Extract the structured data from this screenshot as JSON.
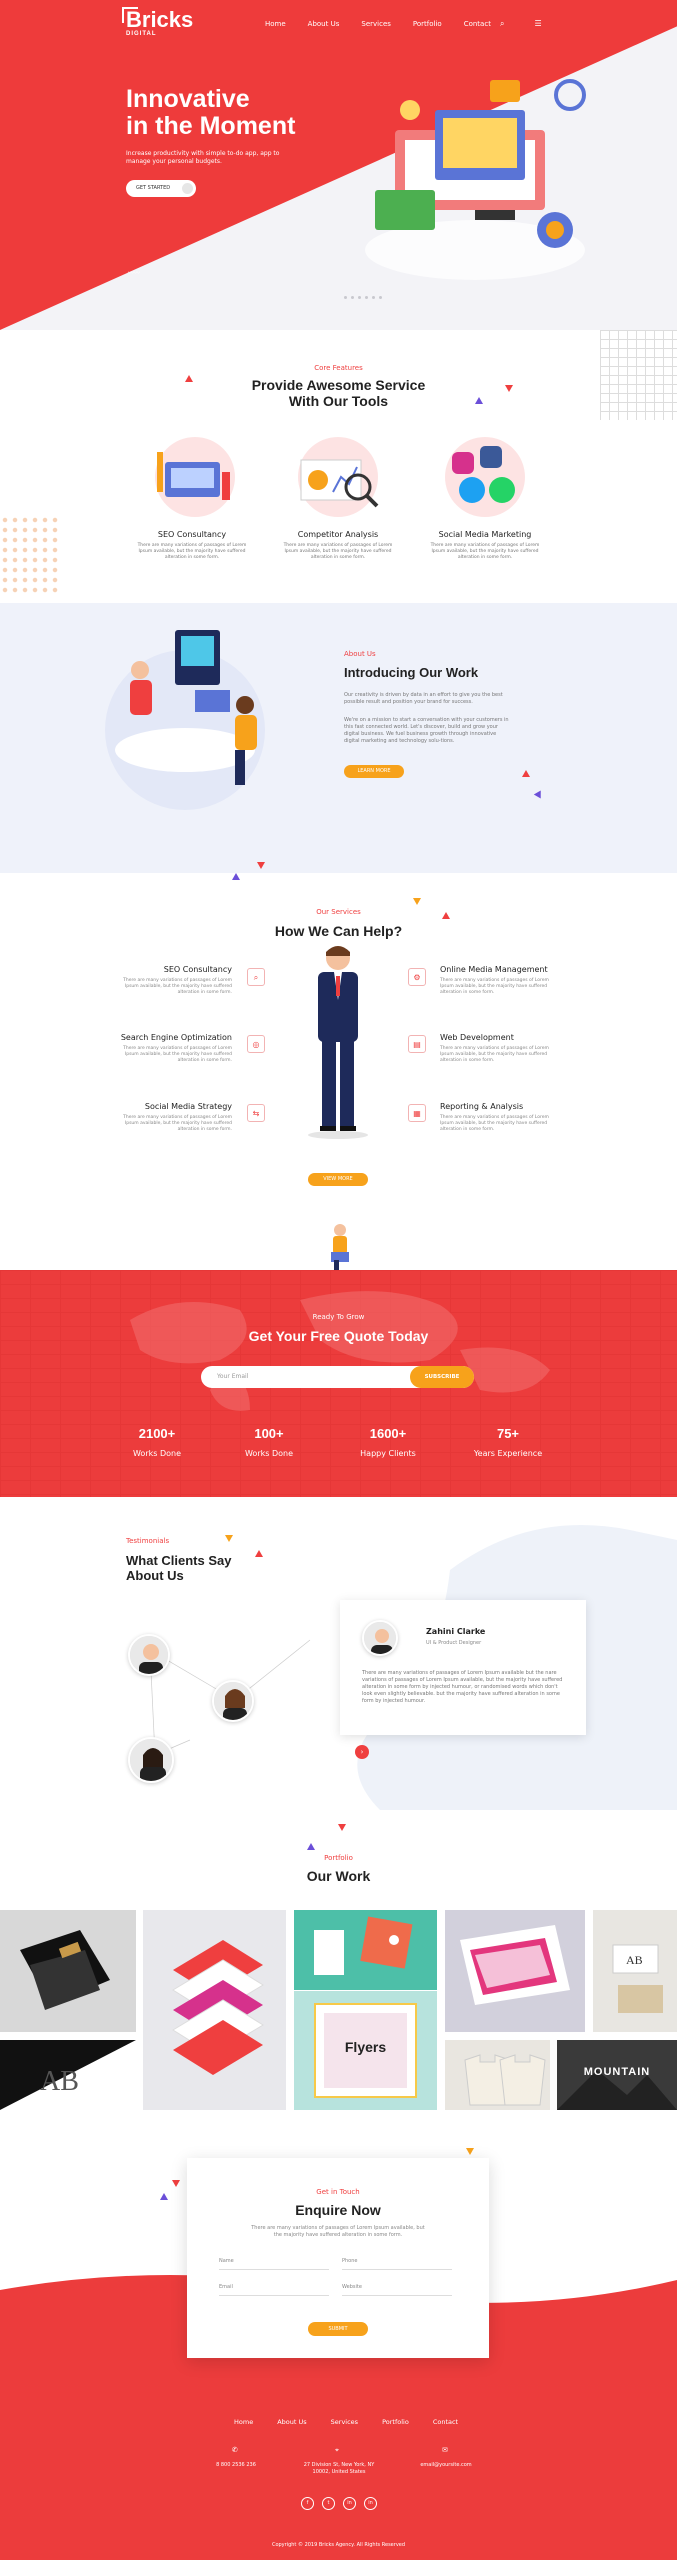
{
  "brand": {
    "name": "Bricks",
    "tag": "DIGITAL"
  },
  "nav": {
    "items": [
      "Home",
      "About Us",
      "Services",
      "Portfolio",
      "Contact"
    ],
    "search_icon": "search-icon",
    "menu_icon": "menu-icon"
  },
  "hero": {
    "title_line1": "Innovative",
    "title_line2": "in the Moment",
    "subtitle": "Increase productivity with simple to-do app, app to manage your personal budgets.",
    "cta": "GET STARTED"
  },
  "features": {
    "eyebrow": "Core Features",
    "title_line1": "Provide Awesome Service",
    "title_line2": "With Our Tools",
    "items": [
      {
        "title": "SEO Consultancy",
        "desc": "There are many variations of passages of Lorem Ipsum available, but the majority have suffered alteration in some form."
      },
      {
        "title": "Competitor Analysis",
        "desc": "There are many variations of passages of Lorem Ipsum available, but the majority have suffered alteration in some form."
      },
      {
        "title": "Social Media Marketing",
        "desc": "There are many variations of passages of Lorem Ipsum available, but the majority have suffered alteration in some form."
      }
    ]
  },
  "about": {
    "eyebrow": "About Us",
    "title": "Introducing Our Work",
    "p1": "Our creativity is driven by data in an effort to give you the best possible result and position your brand for success.",
    "p2": "We're on a mission to start a conversation with your customers in this fast connected world. Let's discover, build and grow your digital business. We fuel business growth through innovative digital marketing and technology solu-tions.",
    "cta": "LEARN MORE"
  },
  "services": {
    "eyebrow": "Our Services",
    "title": "How We Can Help?",
    "desc": "There are many variations of passages of Lorem Ipsum available, but the majority have suffered alteration in some form.",
    "left": [
      "SEO Consultancy",
      "Search Engine Optimization",
      "Social Media Strategy"
    ],
    "right": [
      "Online Media Management",
      "Web Development",
      "Reporting & Analysis"
    ],
    "cta": "VIEW MORE"
  },
  "quote": {
    "eyebrow": "Ready To Grow",
    "title": "Get Your Free Quote Today",
    "email_placeholder": "Your Email",
    "cta": "SUBSCRIBE",
    "stats": [
      {
        "value": "2100+",
        "label": "Works Done"
      },
      {
        "value": "100+",
        "label": "Works Done"
      },
      {
        "value": "1600+",
        "label": "Happy Clients"
      },
      {
        "value": "75+",
        "label": "Years Experience"
      }
    ]
  },
  "testimonials": {
    "eyebrow": "Testimonials",
    "title_line1": "What Clients Say",
    "title_line2": "About Us",
    "name": "Zahini Clarke",
    "role": "UI & Product Designer",
    "text": "There are many variations of passages of Lorem Ipsum available but the nare variations of passages of Lorem Ipsum available, but the majority have suffered alteration in some form by injected humour, or randomised words which don't look even slightly believable. but the majority have suffered alteration in some form by injected humour."
  },
  "portfolio": {
    "eyebrow": "Portfolio",
    "title": "Our Work",
    "flyers_label": "Flyers",
    "mountain_label": "MOUNTAIN"
  },
  "contact": {
    "eyebrow": "Get in Touch",
    "title": "Enquire Now",
    "desc": "There are many variations of passages of Lorem Ipsum available, but the majority have suffered alteration in some form.",
    "fields": [
      "Name",
      "Phone",
      "Email",
      "Website"
    ],
    "cta": "SUBMIT"
  },
  "footer": {
    "nav": [
      "Home",
      "About Us",
      "Services",
      "Portfolio",
      "Contact"
    ],
    "phone": "8 800 2536 236",
    "address_line1": "27 Division St, New York, NY",
    "address_line2": "10002, United States",
    "email": "email@yoursite.com",
    "copyright": "Copyright © 2019 Bricks Agency. All Rights Reserved",
    "social": [
      "f",
      "t",
      "in",
      "in"
    ]
  },
  "colors": {
    "accent": "#ef3f3f",
    "orange": "#f7a21b",
    "bg_light": "#eff2fa"
  }
}
